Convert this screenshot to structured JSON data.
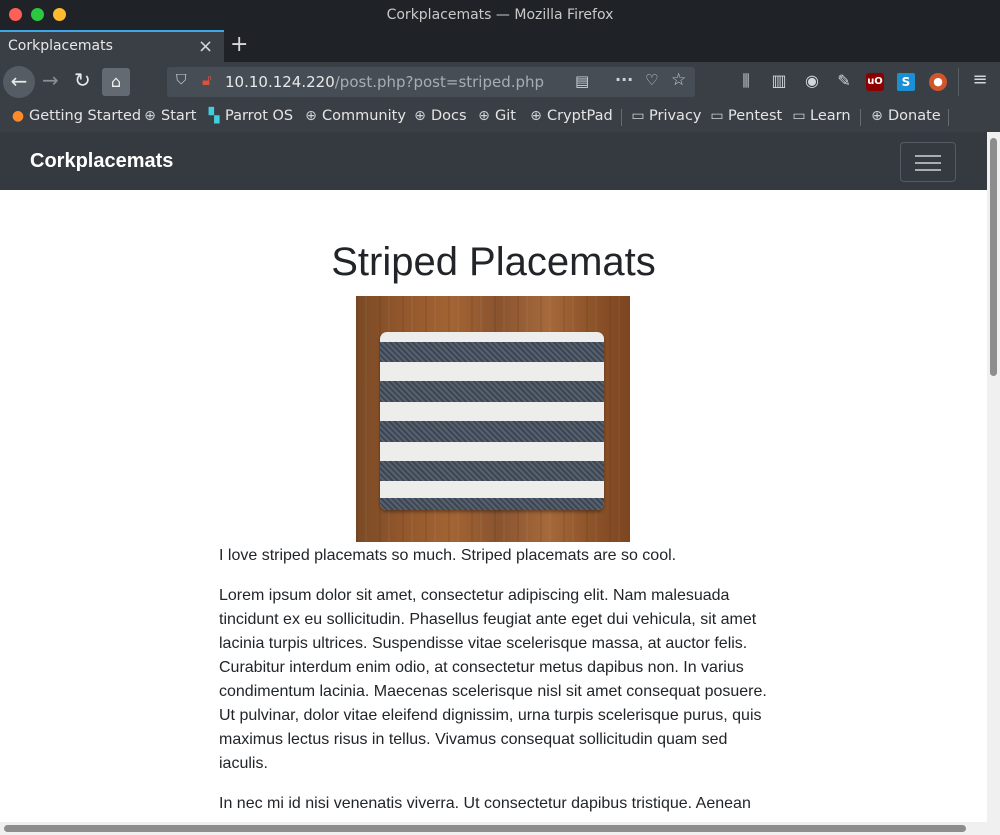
{
  "window": {
    "title": "Corkplacemats — Mozilla Firefox"
  },
  "tab": {
    "label": "Corkplacemats",
    "close": "×",
    "new_tab": "+"
  },
  "toolbar": {
    "back_icon": "←",
    "forward_icon": "→",
    "reload_icon": "↻",
    "home_icon": "⌂",
    "url_host": "10.10.124.220",
    "url_path": "/post.php?post=striped.php",
    "menu_icon": "≡"
  },
  "bookmarks": [
    {
      "label": "Getting Started",
      "icon": "firefox-icon"
    },
    {
      "label": "Start",
      "icon": "globe-icon"
    },
    {
      "label": "Parrot OS",
      "icon": "parrot-icon"
    },
    {
      "label": "Community",
      "icon": "globe-icon"
    },
    {
      "label": "Docs",
      "icon": "globe-icon"
    },
    {
      "label": "Git",
      "icon": "globe-icon"
    },
    {
      "label": "CryptPad",
      "icon": "globe-icon"
    },
    {
      "label": "Privacy",
      "icon": "folder-icon"
    },
    {
      "label": "Pentest",
      "icon": "folder-icon"
    },
    {
      "label": "Learn",
      "icon": "folder-icon"
    },
    {
      "label": "Donate",
      "icon": "globe-icon"
    }
  ],
  "site": {
    "brand": "Corkplacemats",
    "post": {
      "title": "Striped Placemats",
      "image_description": "Striped placemat on wooden table",
      "paragraphs": [
        "I love striped placemats so much. Striped placemats are so cool.",
        "Lorem ipsum dolor sit amet, consectetur adipiscing elit. Nam malesuada tincidunt ex eu sollicitudin. Phasellus feugiat ante eget dui vehicula, sit amet lacinia turpis ultrices. Suspendisse vitae scelerisque massa, at auctor felis. Curabitur interdum enim odio, at consectetur metus dapibus non. In varius condimentum lacinia. Maecenas scelerisque nisl sit amet consequat posuere. Ut pulvinar, dolor vitae eleifend dignissim, urna turpis scelerisque purus, quis maximus lectus risus in tellus. Vivamus consequat sollicitudin quam sed iaculis.",
        "In nec mi id nisi venenatis viverra. Ut consectetur dapibus tristique. Aenean"
      ]
    }
  },
  "colors": {
    "site_nav_bg": "#343a40",
    "browser_chrome": "#3a3f46",
    "tab_accent": "#3fa7e6"
  }
}
